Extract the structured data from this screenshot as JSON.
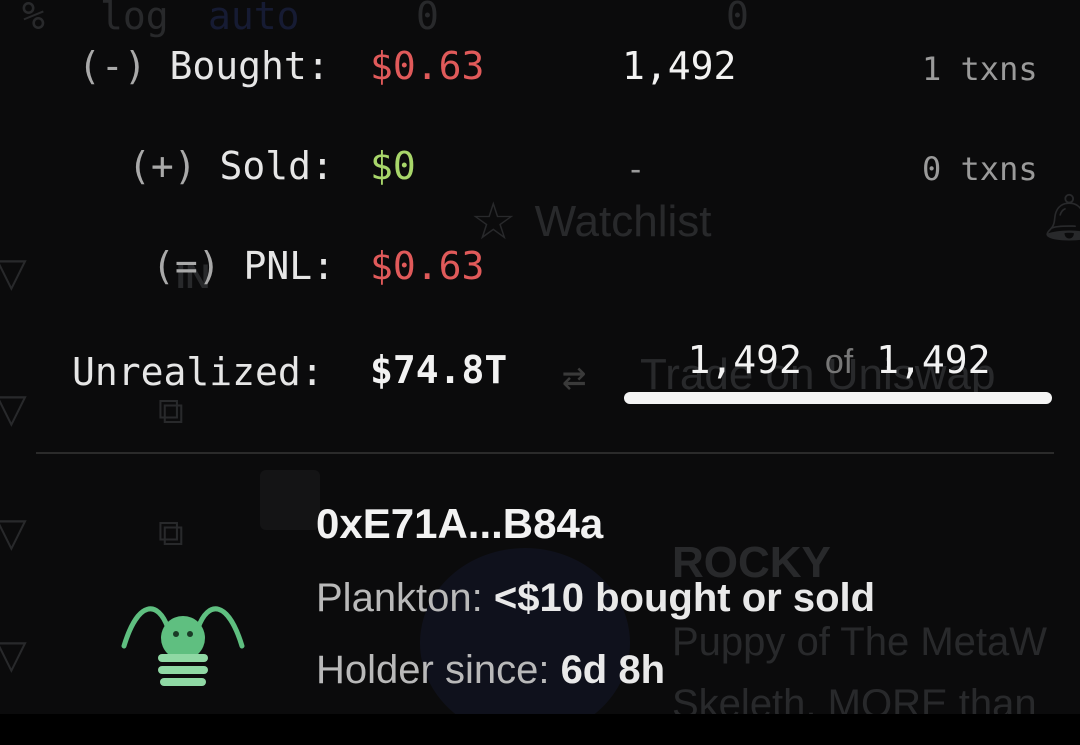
{
  "background": {
    "top_labels": [
      "%",
      "log",
      "auto",
      "0",
      "0"
    ],
    "watchlist": "Watchlist",
    "trade_link": "Trade on Uniswap",
    "token_name": "ROCKY",
    "token_desc_1": "Puppy of The MetaW",
    "token_desc_2": "Skeleth. MORE than",
    "side_label": "IN"
  },
  "summary": {
    "bought": {
      "sign": "(-)",
      "label": "Bought:",
      "value": "$0.63",
      "amount": "1,492",
      "txns": "1 txns"
    },
    "sold": {
      "sign": "(+)",
      "label": "Sold:",
      "value": "$0",
      "amount": "-",
      "txns": "0 txns"
    },
    "pnl": {
      "sign": "(=)",
      "label": "PNL:",
      "value": "$0.63"
    },
    "unrealized": {
      "label": "Unrealized:",
      "value": "$74.8T",
      "held": "1,492",
      "of_word": "of",
      "total": "1,492",
      "fraction_held": 1.0
    }
  },
  "holder": {
    "address": "0xE71A...B84a",
    "tier_label": "Plankton:",
    "tier_desc": "<$10 bought or sold",
    "since_label": "Holder since:",
    "since_value": "6d 8h"
  },
  "colors": {
    "loss": "#e05a5a",
    "gain": "#a8d66a",
    "plankton": "#5fbf80"
  },
  "icons": [
    "swap-arrows-icon",
    "plankton-icon",
    "star-icon",
    "bell-icon",
    "filter-icon",
    "external-link-icon"
  ]
}
